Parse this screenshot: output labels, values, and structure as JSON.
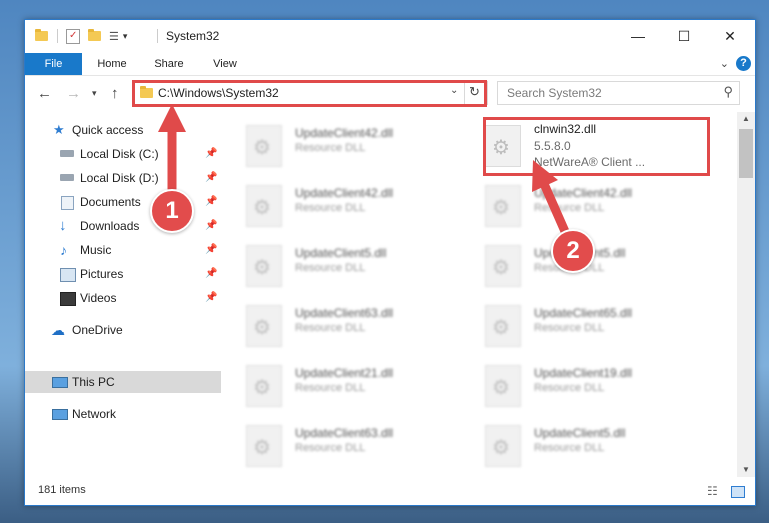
{
  "window": {
    "title": "System32"
  },
  "ribbon": {
    "tabs": [
      "File",
      "Home",
      "Share",
      "View"
    ],
    "help": "?"
  },
  "address": {
    "path": "C:\\Windows\\System32"
  },
  "search": {
    "placeholder": "Search System32"
  },
  "nav": {
    "items": [
      {
        "label": "Quick access"
      },
      {
        "label": "Local Disk (C:)"
      },
      {
        "label": "Local Disk (D:)"
      },
      {
        "label": "Documents"
      },
      {
        "label": "Downloads"
      },
      {
        "label": "Music"
      },
      {
        "label": "Pictures"
      },
      {
        "label": "Videos"
      },
      {
        "label": "OneDrive"
      },
      {
        "label": "This PC"
      },
      {
        "label": "Network"
      }
    ]
  },
  "files": {
    "left": [
      {
        "name": "UpdateClient42.dll",
        "desc": "Resource DLL"
      },
      {
        "name": "UpdateClient42.dll",
        "desc": "Resource DLL"
      },
      {
        "name": "UpdateClient5.dll",
        "desc": "Resource DLL"
      },
      {
        "name": "UpdateClient63.dll",
        "desc": "Resource DLL"
      },
      {
        "name": "UpdateClient21.dll",
        "desc": "Resource DLL"
      },
      {
        "name": "UpdateClient63.dll",
        "desc": "Resource DLL"
      }
    ],
    "right": [
      {
        "name": "clnwin32.dll",
        "version": "5.5.8.0",
        "desc": "NetWareA® Client ..."
      },
      {
        "name": "UpdateClient42.dll",
        "desc": "Resource DLL"
      },
      {
        "name": "UpdateClient5.dll",
        "desc": "Resource DLL"
      },
      {
        "name": "UpdateClient65.dll",
        "desc": "Resource DLL"
      },
      {
        "name": "UpdateClient19.dll",
        "desc": "Resource DLL"
      },
      {
        "name": "UpdateClient5.dll",
        "desc": "Resource DLL"
      }
    ]
  },
  "status": {
    "item_count": "181 items"
  },
  "annotations": {
    "step1": "1",
    "step2": "2",
    "color": "#e04a4a"
  }
}
